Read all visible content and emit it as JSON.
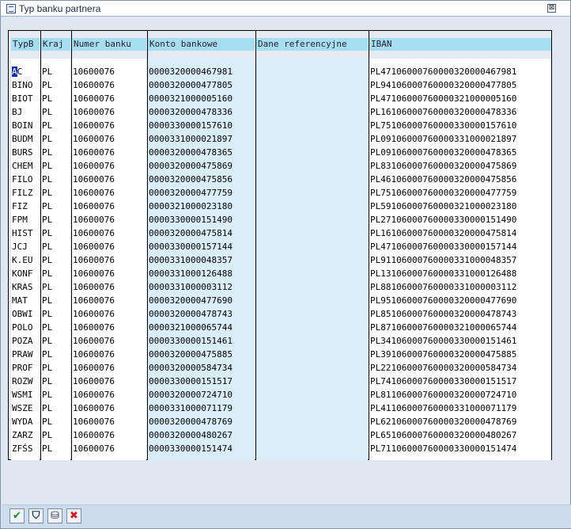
{
  "window": {
    "title": "Typ banku partnera",
    "close_glyph": "⊠"
  },
  "table": {
    "headers": {
      "typ": "TypB",
      "kraj": "Kraj",
      "numer": "Numer banku",
      "konto": "Konto bankowe",
      "dane": "Dane referencyjne",
      "iban": "IBAN"
    },
    "rows": [
      {
        "typ": "AC",
        "kraj": "PL",
        "numer": "10600076",
        "konto": "0000320000467981",
        "dane": "",
        "iban": "PL47106000760000320000467981"
      },
      {
        "typ": "BINO",
        "kraj": "PL",
        "numer": "10600076",
        "konto": "0000320000477805",
        "dane": "",
        "iban": "PL94106000760000320000477805"
      },
      {
        "typ": "BIOT",
        "kraj": "PL",
        "numer": "10600076",
        "konto": "0000321000005160",
        "dane": "",
        "iban": "PL47106000760000321000005160"
      },
      {
        "typ": "BJ",
        "kraj": "PL",
        "numer": "10600076",
        "konto": "0000320000478336",
        "dane": "",
        "iban": "PL16106000760000320000478336"
      },
      {
        "typ": "BOIN",
        "kraj": "PL",
        "numer": "10600076",
        "konto": "0000330000157610",
        "dane": "",
        "iban": "PL75106000760000330000157610"
      },
      {
        "typ": "BUDM",
        "kraj": "PL",
        "numer": "10600076",
        "konto": "0000331000021897",
        "dane": "",
        "iban": "PL09106000760000331000021897"
      },
      {
        "typ": "BURS",
        "kraj": "PL",
        "numer": "10600076",
        "konto": "0000320000478365",
        "dane": "",
        "iban": "PL09106000760000320000478365"
      },
      {
        "typ": "CHEM",
        "kraj": "PL",
        "numer": "10600076",
        "konto": "0000320000475869",
        "dane": "",
        "iban": "PL83106000760000320000475869"
      },
      {
        "typ": "FILO",
        "kraj": "PL",
        "numer": "10600076",
        "konto": "0000320000475856",
        "dane": "",
        "iban": "PL46106000760000320000475856"
      },
      {
        "typ": "FILZ",
        "kraj": "PL",
        "numer": "10600076",
        "konto": "0000320000477759",
        "dane": "",
        "iban": "PL75106000760000320000477759"
      },
      {
        "typ": "FIZ",
        "kraj": "PL",
        "numer": "10600076",
        "konto": "0000321000023180",
        "dane": "",
        "iban": "PL59106000760000321000023180"
      },
      {
        "typ": "FPM",
        "kraj": "PL",
        "numer": "10600076",
        "konto": "0000330000151490",
        "dane": "",
        "iban": "PL27106000760000330000151490"
      },
      {
        "typ": "HIST",
        "kraj": "PL",
        "numer": "10600076",
        "konto": "0000320000475814",
        "dane": "",
        "iban": "PL16106000760000320000475814"
      },
      {
        "typ": "JCJ",
        "kraj": "PL",
        "numer": "10600076",
        "konto": "0000330000157144",
        "dane": "",
        "iban": "PL47106000760000330000157144"
      },
      {
        "typ": "K.EU",
        "kraj": "PL",
        "numer": "10600076",
        "konto": "0000331000048357",
        "dane": "",
        "iban": "PL91106000760000331000048357"
      },
      {
        "typ": "KONF",
        "kraj": "PL",
        "numer": "10600076",
        "konto": "0000331000126488",
        "dane": "",
        "iban": "PL13106000760000331000126488"
      },
      {
        "typ": "KRAS",
        "kraj": "PL",
        "numer": "10600076",
        "konto": "0000331000003112",
        "dane": "",
        "iban": "PL88106000760000331000003112"
      },
      {
        "typ": "MAT",
        "kraj": "PL",
        "numer": "10600076",
        "konto": "0000320000477690",
        "dane": "",
        "iban": "PL95106000760000320000477690"
      },
      {
        "typ": "OBWI",
        "kraj": "PL",
        "numer": "10600076",
        "konto": "0000320000478743",
        "dane": "",
        "iban": "PL85106000760000320000478743"
      },
      {
        "typ": "POLO",
        "kraj": "PL",
        "numer": "10600076",
        "konto": "0000321000065744",
        "dane": "",
        "iban": "PL87106000760000321000065744"
      },
      {
        "typ": "POZA",
        "kraj": "PL",
        "numer": "10600076",
        "konto": "0000330000151461",
        "dane": "",
        "iban": "PL34106000760000330000151461"
      },
      {
        "typ": "PRAW",
        "kraj": "PL",
        "numer": "10600076",
        "konto": "0000320000475885",
        "dane": "",
        "iban": "PL39106000760000320000475885"
      },
      {
        "typ": "PROF",
        "kraj": "PL",
        "numer": "10600076",
        "konto": "0000320000584734",
        "dane": "",
        "iban": "PL22106000760000320000584734"
      },
      {
        "typ": "ROZW",
        "kraj": "PL",
        "numer": "10600076",
        "konto": "0000330000151517",
        "dane": "",
        "iban": "PL74106000760000330000151517"
      },
      {
        "typ": "WSMI",
        "kraj": "PL",
        "numer": "10600076",
        "konto": "0000320000724710",
        "dane": "",
        "iban": "PL81106000760000320000724710"
      },
      {
        "typ": "WSZE",
        "kraj": "PL",
        "numer": "10600076",
        "konto": "0000331000071179",
        "dane": "",
        "iban": "PL41106000760000331000071179"
      },
      {
        "typ": "WYDA",
        "kraj": "PL",
        "numer": "10600076",
        "konto": "0000320000478769",
        "dane": "",
        "iban": "PL62106000760000320000478769"
      },
      {
        "typ": "ZARZ",
        "kraj": "PL",
        "numer": "10600076",
        "konto": "0000320000480267",
        "dane": "",
        "iban": "PL65106000760000320000480267"
      },
      {
        "typ": "ZFŚS",
        "kraj": "PL",
        "numer": "10600076",
        "konto": "0000330000151474",
        "dane": "",
        "iban": "PL71106000760000330000151474"
      }
    ]
  },
  "toolbar": {
    "buttons": [
      {
        "name": "confirm-button",
        "icon": "checkmark-icon",
        "glyph": "✔",
        "color": "#1e8c1e"
      },
      {
        "name": "filter-button",
        "icon": "filter-icon",
        "glyph": "⛉",
        "color": "#1c2c44"
      },
      {
        "name": "find-button",
        "icon": "binoculars-icon",
        "glyph": "⛁",
        "color": "#1c2c44"
      },
      {
        "name": "cancel-button",
        "icon": "cross-icon",
        "glyph": "✖",
        "color": "#cc1f1f"
      }
    ]
  },
  "colors": {
    "header_bg": "#a6ddf0",
    "cursor_bg": "#0a2fa8",
    "window_bg": "#dfe8f2"
  }
}
